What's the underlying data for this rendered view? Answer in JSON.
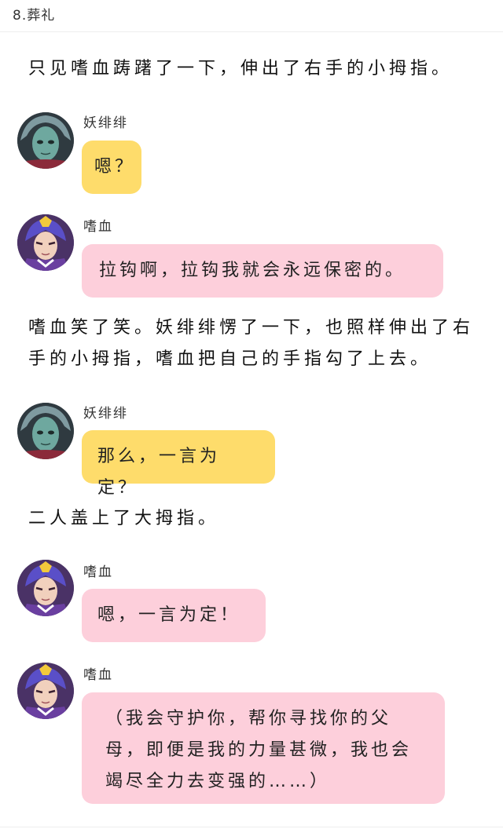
{
  "header": {
    "title": "8.葬礼"
  },
  "speakers": {
    "yao": {
      "name": "妖绯绯"
    },
    "shi": {
      "name": "嗜血"
    }
  },
  "story": {
    "narration_1": "只见嗜血踌躇了一下，伸出了右手的小拇指。",
    "msg_1": "嗯？",
    "msg_2": "拉钩啊，拉钩我就会永远保密的。",
    "narration_2": "嗜血笑了笑。妖绯绯愣了一下，也照样伸出了右手的小拇指，嗜血把自己的手指勾了上去。",
    "msg_3": "那么，一言为定？",
    "narration_3": "二人盖上了大拇指。",
    "msg_4": "嗯，一言为定！",
    "msg_5": "（我会守护你，帮你寻找你的父母，即便是我的力量甚微，我也会竭尽全力去变强的……）"
  },
  "colors": {
    "yellow_bubble": "#fedc6b",
    "pink_bubble": "#fdcfdb"
  },
  "icons": {
    "yao_avatar": "teal-alien-girl-avatar",
    "shi_avatar": "purple-armored-boy-avatar"
  }
}
